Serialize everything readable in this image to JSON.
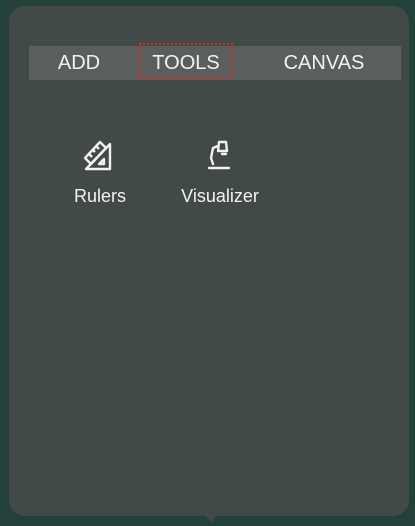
{
  "tabs": [
    {
      "label": "ADD"
    },
    {
      "label": "TOOLS",
      "selected": true
    },
    {
      "label": "CANVAS"
    }
  ],
  "tools": [
    {
      "label": "Rulers",
      "icon": "ruler-icon"
    },
    {
      "label": "Visualizer",
      "icon": "visualizer-icon"
    }
  ],
  "colors": {
    "background": "#24403a",
    "panel": "#414a47",
    "tabbar": "#5a5f5d",
    "text": "#f2f2f2",
    "focus_outline": "#d42a2a"
  }
}
